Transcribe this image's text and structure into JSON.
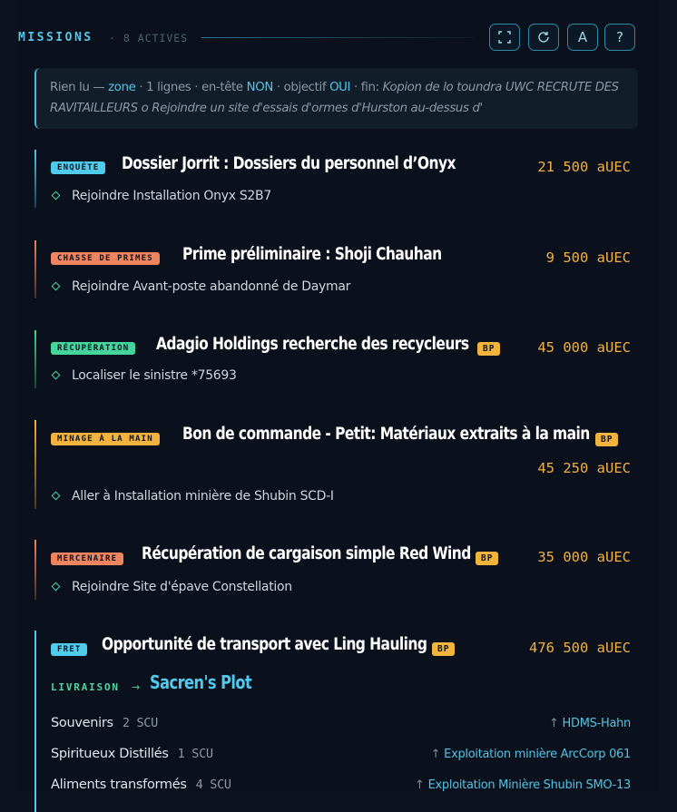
{
  "header": {
    "title": "MISSIONS",
    "count": "· 8 ACTIVES",
    "buttons": [
      {
        "icon": "fullscreen-icon",
        "label": ""
      },
      {
        "icon": "refresh-icon",
        "label": ""
      },
      {
        "icon": "font-icon",
        "label": "A"
      },
      {
        "icon": "help-icon",
        "label": "?"
      }
    ]
  },
  "info": {
    "prefix": "Rien lu —",
    "zone_kw": "zone",
    "lines": "· 1 lignes · en-tête",
    "header_kw": "NON",
    "objective": "· objectif",
    "objective_kw": "OUI",
    "fin_label": "· fin:",
    "fin_text": "Kopion de lo toundra UWC RECRUTE DES RAVITAILLEURS o Rejoindre un site d'essais d'ormes d'Hurston au-dessus d'"
  },
  "missions": [
    {
      "category": "ENQUÊTE",
      "color": "#4fcbec",
      "title": "Dossier Jorrit : Dossiers du personnel d’Onyx",
      "bp": "",
      "reward": "21 500",
      "currency": "aUEC",
      "objective": "Rejoindre Installation Onyx S2B7"
    },
    {
      "category": "CHASSE DE PRIMES",
      "color": "#f0845e",
      "title": "Prime préliminaire : Shoji Chauhan",
      "bp": "",
      "reward": "9 500",
      "currency": "aUEC",
      "objective": "Rejoindre Avant-poste abandonné de Daymar"
    },
    {
      "category": "RÉCUPÉRATION",
      "color": "#45d59a",
      "title": "Adagio Holdings recherche des recycleurs",
      "bp": "BP",
      "reward": "45 000",
      "currency": "aUEC",
      "objective": "Localiser le sinistre *75693"
    },
    {
      "category": "MINAGE À LA MAIN",
      "color": "#f2b23d",
      "title": "Bon de commande - Petit: Matériaux extraits à la main",
      "bp": "BP",
      "reward": "45 250",
      "currency": "aUEC",
      "objective": "Aller à Installation minière de Shubin SCD-I"
    },
    {
      "category": "MERCENAIRE",
      "color": "#f0845e",
      "title": "Récupération de cargaison simple Red Wind",
      "bp": "BP",
      "reward": "35 000",
      "currency": "aUEC",
      "objective": "Rejoindre Site d'épave Constellation"
    },
    {
      "category": "FRET",
      "color": "#4fcbec",
      "title": "Opportunité de transport avec Ling Hauling",
      "bp": "BP",
      "reward": "476 500",
      "currency": "aUEC",
      "delivery_label": "LIVRAISON",
      "delivery_arrow": "→",
      "delivery_dest": "Sacren's Plot",
      "cargo": [
        {
          "name": "Souvenirs",
          "qty": "2",
          "unit": "SCU",
          "arrow": "↑",
          "location": "HDMS-Hahn"
        },
        {
          "name": "Spiritueux Distillés",
          "qty": "1",
          "unit": "SCU",
          "arrow": "↑",
          "location": "Exploitation minière ArcCorp 061"
        },
        {
          "name": "Aliments transformés",
          "qty": "4",
          "unit": "SCU",
          "arrow": "↑",
          "location": "Exploitation Minière Shubin SMO-13"
        }
      ]
    }
  ]
}
